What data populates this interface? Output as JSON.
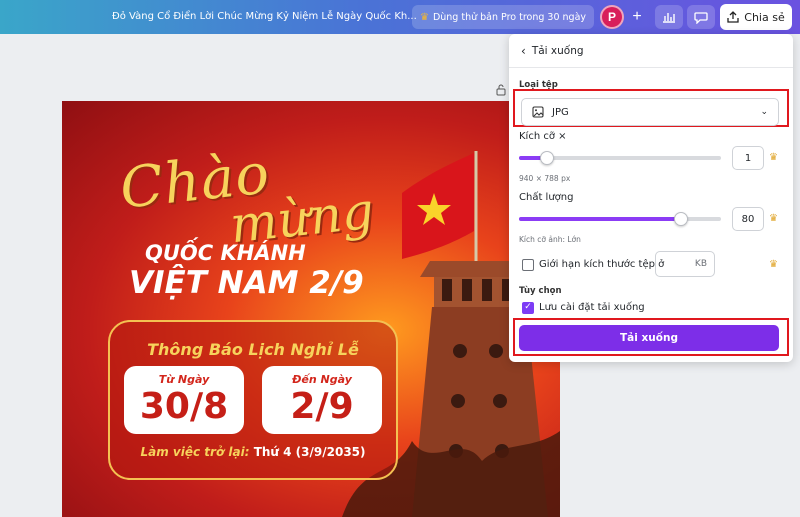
{
  "topbar": {
    "doc_title": "Đỏ Vàng Cổ Điển Lời Chúc Mừng Kỷ Niệm Lễ Ngày Quốc Kh...",
    "pro_trial_label": "Dùng thử bản Pro trong 30 ngày",
    "avatar_initial": "P",
    "share_label": "Chia sẻ",
    "accent": "#6a52e0"
  },
  "poster": {
    "chao": "Chào",
    "mung": "mừng",
    "quoc_khanh": "QUỐC KHÁNH",
    "viet_nam": "VIỆT NAM 2/9",
    "notice_title": "Thông Báo Lịch Nghỉ Lễ",
    "from_label": "Từ Ngày",
    "from_value": "30/8",
    "to_label": "Đến Ngày",
    "to_value": "2/9",
    "return_prefix": "Làm việc trở lại:",
    "return_value": "Thứ 4 (3/9/2035)"
  },
  "panel": {
    "title": "Tải xuống",
    "file_type_label": "Loại tệp",
    "file_type_value": "JPG",
    "size_label": "Kích cỡ ×",
    "size_value": "1",
    "size_level": 0.14,
    "dimensions": "940 × 788 px",
    "quality_label": "Chất lượng",
    "quality_value": "80",
    "quality_level": 0.8,
    "file_size_hint": "Kích cỡ ảnh: Lớn",
    "limit_label": "Giới hạn kích thước tệp ở",
    "limit_unit": "KB",
    "options_label": "Tùy chọn",
    "save_settings_label": "Lưu cài đặt tải xuống",
    "download_button": "Tải xuống",
    "button_color": "#7d2ee8"
  }
}
